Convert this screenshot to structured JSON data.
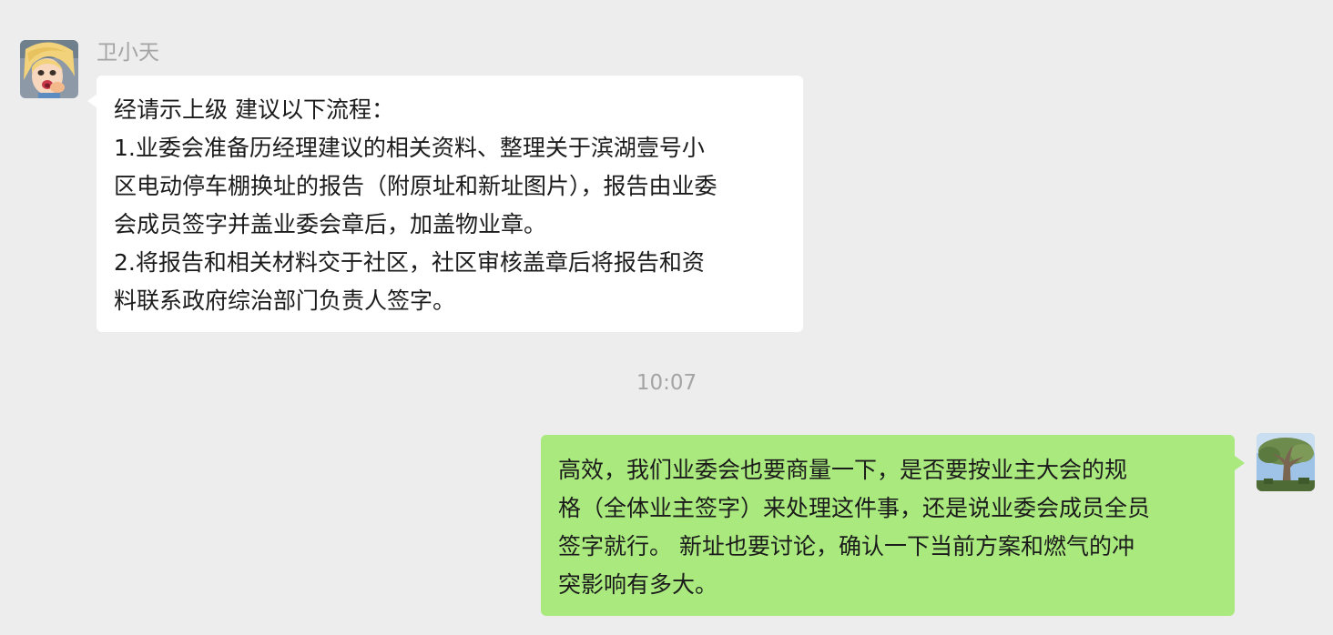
{
  "chat": {
    "timestamp": "10:07",
    "incoming": {
      "sender_name": "卫小天",
      "avatar_icon": "cartoon-princess-avatar",
      "lines": [
        "经请示上级 建议以下流程：",
        "1.业委会准备历经理建议的相关资料、整理关于滨湖壹号小",
        "区电动停车棚换址的报告（附原址和新址图片），报告由业委",
        "会成员签字并盖业委会章后，加盖物业章。",
        "2.将报告和相关材料交于社区，社区审核盖章后将报告和资",
        "料联系政府综治部门负责人签字。"
      ]
    },
    "outgoing": {
      "avatar_icon": "tree-photo-avatar",
      "lines": [
        "高效，我们业委会也要商量一下，是否要按业主大会的规",
        "格（全体业主签字）来处理这件事，还是说业委会成员全员",
        "签字就行。 新址也要讨论，确认一下当前方案和燃气的冲",
        "突影响有多大。"
      ]
    }
  },
  "colors": {
    "background": "#ededed",
    "incoming_bubble": "#ffffff",
    "outgoing_bubble": "#a9e97e",
    "meta_text": "#a4a4a4",
    "message_text": "#1b1b1b"
  }
}
